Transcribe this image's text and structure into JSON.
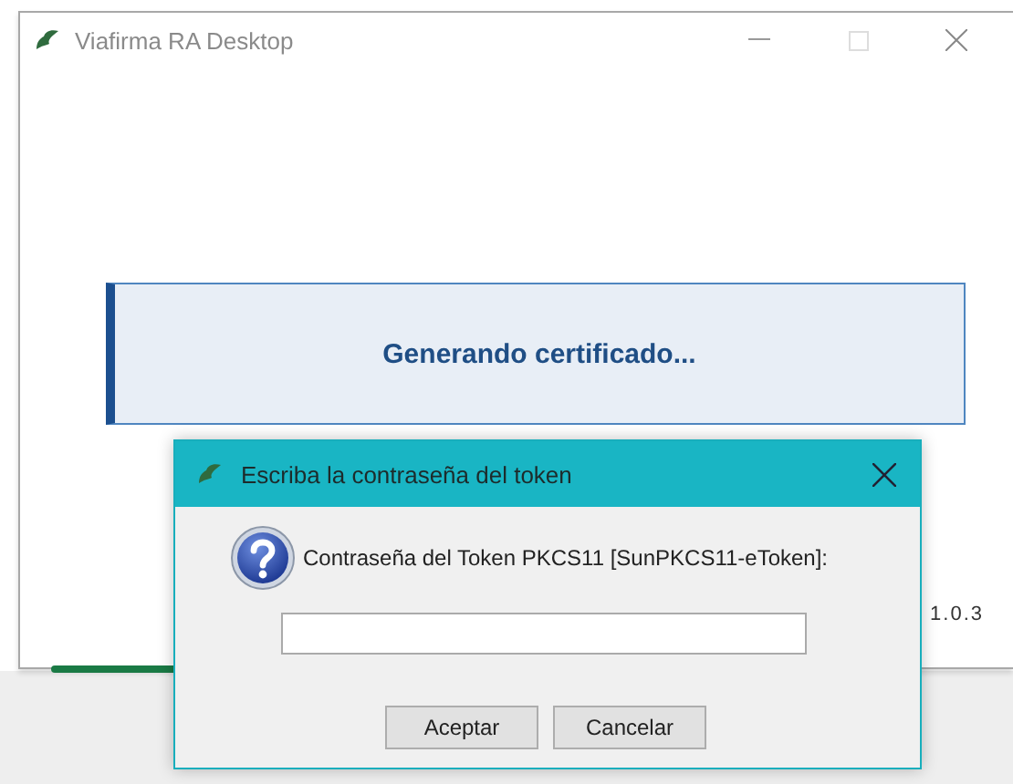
{
  "main_window": {
    "title": "Viafirma RA Desktop",
    "status": "Generando certificado...",
    "version": "1.0.3"
  },
  "dialog": {
    "title": "Escriba la contraseña del token",
    "prompt": "Contraseña del Token PKCS11 [SunPKCS11-eToken]:",
    "buttons": [
      "Aceptar",
      "Cancelar"
    ]
  }
}
